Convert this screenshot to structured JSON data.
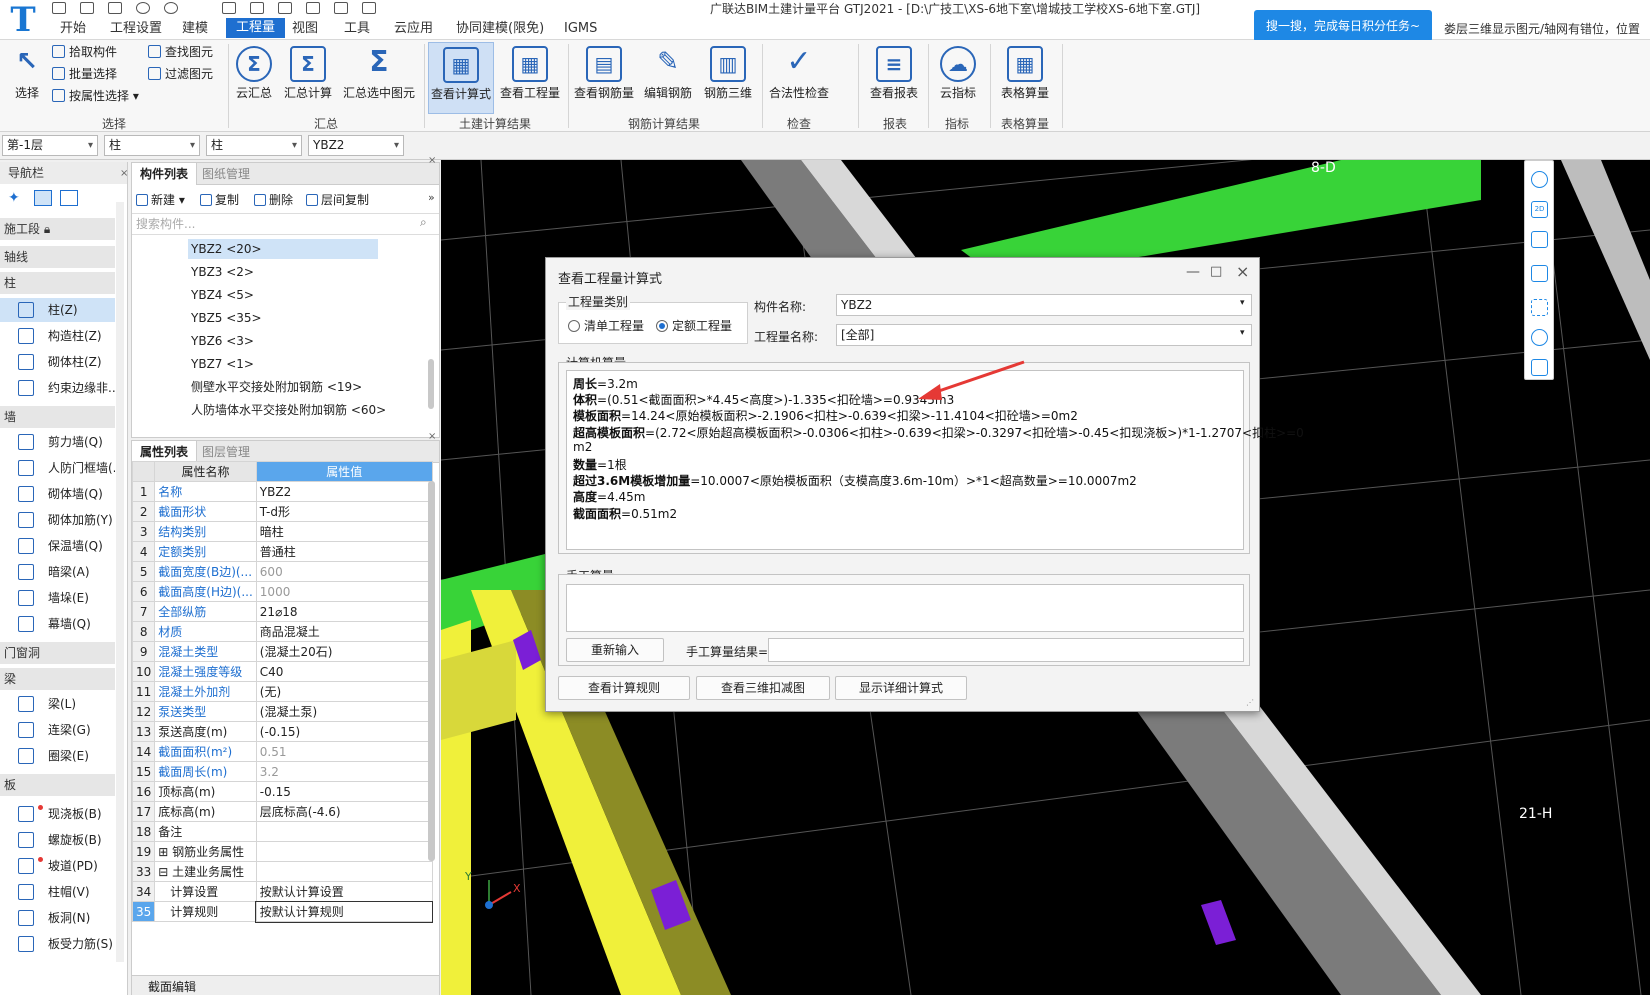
{
  "app": {
    "logo": "T",
    "title": "广联达BIM土建计量平台 GTJ2021 - [D:\\广技工\\XS-6地下室\\增城技工学校XS-6地下室.GTJ]",
    "search_tip": "搜一搜，完成每日积分任务~",
    "right_tip": "娄层三维显示图元/轴网有错位，位置"
  },
  "menu": [
    "开始",
    "工程设置",
    "建模",
    "工程量",
    "视图",
    "工具",
    "云应用",
    "协同建模(限免)",
    "IGMS"
  ],
  "menu_active": "工程量",
  "ribbon": {
    "select": {
      "big": "选择",
      "small": [
        "拾取构件",
        "批量选择",
        "按属性选择",
        "查找图元",
        "过滤图元"
      ],
      "group": "选择"
    },
    "summary": {
      "buttons": [
        "云汇总",
        "汇总计算",
        "汇总选中图元"
      ],
      "group": "汇总"
    },
    "civil": {
      "buttons": [
        "查看计算式",
        "查看工程量"
      ],
      "group": "土建计算结果"
    },
    "rebar": {
      "buttons": [
        "查看钢筋量",
        "编辑钢筋",
        "钢筋三维"
      ],
      "group": "钢筋计算结果"
    },
    "check": {
      "buttons": [
        "合法性检查"
      ],
      "group": "检查"
    },
    "report": {
      "buttons": [
        "查看报表"
      ],
      "group": "报表"
    },
    "index": {
      "buttons": [
        "云指标"
      ],
      "group": "指标"
    },
    "table": {
      "buttons": [
        "表格算量"
      ],
      "group": "表格算量"
    }
  },
  "combos": [
    "第-1层",
    "柱",
    "柱",
    "YBZ2"
  ],
  "nav": {
    "title": "导航栏",
    "categories": [
      "施工段",
      "轴线",
      "柱",
      "墙",
      "门窗洞",
      "梁",
      "板"
    ],
    "col_items": [
      "柱(Z)",
      "构造柱(Z)",
      "砌体柱(Z)",
      "约束边缘非..."
    ],
    "wall_items": [
      "剪力墙(Q)",
      "人防门框墙(...",
      "砌体墙(Q)",
      "砌体加筋(Y)",
      "保温墙(Q)",
      "暗梁(A)",
      "墙垛(E)",
      "幕墙(Q)"
    ],
    "beam_items": [
      "梁(L)",
      "连梁(G)",
      "圈梁(E)"
    ],
    "slab_items": [
      "现浇板(B)",
      "螺旋板(B)",
      "坡道(PD)",
      "柱帽(V)",
      "板洞(N)",
      "板受力筋(S)"
    ]
  },
  "comp_list": {
    "tabs": [
      "构件列表",
      "图纸管理"
    ],
    "toolbar": [
      "新建",
      "复制",
      "删除",
      "层间复制"
    ],
    "search_placeholder": "搜索构件...",
    "items": [
      "YBZ2 <20>",
      "YBZ3 <2>",
      "YBZ4 <5>",
      "YBZ5 <35>",
      "YBZ6 <3>",
      "YBZ7 <1>",
      "侧壁水平交接处附加钢筋 <19>",
      "人防墙体水平交接处附加钢筋 <60>"
    ]
  },
  "prop_list": {
    "tabs": [
      "属性列表",
      "图层管理"
    ],
    "col_name": "属性名称",
    "col_value": "属性值",
    "rows": [
      {
        "n": "1",
        "name": "名称",
        "val": "YBZ2",
        "blue": true,
        "gray": false
      },
      {
        "n": "2",
        "name": "截面形状",
        "val": "T-d形",
        "blue": true,
        "gray": false
      },
      {
        "n": "3",
        "name": "结构类别",
        "val": "暗柱",
        "blue": true,
        "gray": false
      },
      {
        "n": "4",
        "name": "定额类别",
        "val": "普通柱",
        "blue": true,
        "gray": false
      },
      {
        "n": "5",
        "name": "截面宽度(B边)(...",
        "val": "600",
        "blue": true,
        "gray": true
      },
      {
        "n": "6",
        "name": "截面高度(H边)(...",
        "val": "1000",
        "blue": true,
        "gray": true
      },
      {
        "n": "7",
        "name": "全部纵筋",
        "val": "21⌀18",
        "blue": true,
        "gray": false
      },
      {
        "n": "8",
        "name": "材质",
        "val": "商品混凝土",
        "blue": true,
        "gray": false
      },
      {
        "n": "9",
        "name": "混凝土类型",
        "val": "(混凝土20石)",
        "blue": true,
        "gray": false
      },
      {
        "n": "10",
        "name": "混凝土强度等级",
        "val": "C40",
        "blue": true,
        "gray": false
      },
      {
        "n": "11",
        "name": "混凝土外加剂",
        "val": "(无)",
        "blue": true,
        "gray": false
      },
      {
        "n": "12",
        "name": "泵送类型",
        "val": "(混凝土泵)",
        "blue": true,
        "gray": false
      },
      {
        "n": "13",
        "name": "泵送高度(m)",
        "val": "(-0.15)",
        "blue": false,
        "gray": false
      },
      {
        "n": "14",
        "name": "截面面积(m²)",
        "val": "0.51",
        "blue": true,
        "gray": true
      },
      {
        "n": "15",
        "name": "截面周长(m)",
        "val": "3.2",
        "blue": true,
        "gray": true
      },
      {
        "n": "16",
        "name": "顶标高(m)",
        "val": "-0.15",
        "blue": false,
        "gray": false
      },
      {
        "n": "17",
        "name": "底标高(m)",
        "val": "层底标高(-4.6)",
        "blue": false,
        "gray": false
      },
      {
        "n": "18",
        "name": "备注",
        "val": "",
        "blue": false,
        "gray": false
      },
      {
        "n": "19",
        "name": "⊞ 钢筋业务属性",
        "val": "",
        "blue": false,
        "gray": false
      },
      {
        "n": "33",
        "name": "⊟ 土建业务属性",
        "val": "",
        "blue": false,
        "gray": false
      },
      {
        "n": "34",
        "name": "　计算设置",
        "val": "按默认计算设置",
        "blue": false,
        "gray": false
      },
      {
        "n": "35",
        "name": "　计算规则",
        "val": "按默认计算规则",
        "blue": false,
        "gray": false
      }
    ],
    "bottom_tab": "截面编辑"
  },
  "dialog": {
    "title": "查看工程量计算式",
    "group_type": "工程量类别",
    "radio1": "清单工程量",
    "radio2": "定额工程量",
    "comp_name_label": "构件名称:",
    "comp_name_value": "YBZ2",
    "qty_name_label": "工程量名称:",
    "qty_name_value": "[全部]",
    "computer_label": "计算机算量",
    "lines": [
      {
        "k": "周长",
        "v": "=3.2m"
      },
      {
        "k": "体积",
        "v": "=(0.51<截面面积>*4.45<高度>)-1.335<扣砼墙>=0.9345m3"
      },
      {
        "k": "模板面积",
        "v": "=14.24<原始模板面积>-2.1906<扣柱>-0.639<扣梁>-11.4104<扣砼墙>=0m2"
      },
      {
        "k": "超高模板面积",
        "v": "=(2.72<原始超高模板面积>-0.0306<扣柱>-0.639<扣梁>-0.3297<扣砼墙>-0.45<扣现浇板>)*1-1.2707<扣柱>=0"
      },
      {
        "k": "",
        "v": "m2"
      },
      {
        "k": "数量",
        "v": "=1根"
      },
      {
        "k": "超过3.6M模板增加量",
        "v": "=10.0007<原始模板面积（支模高度3.6m-10m）>*1<超高数量>=10.0007m2"
      },
      {
        "k": "高度",
        "v": "=4.45m"
      },
      {
        "k": "截面面积",
        "v": "=0.51m2"
      }
    ],
    "manual_label": "手工算量",
    "reinput": "重新输入",
    "manual_result_label": "手工算量结果=",
    "btn_rules": "查看计算规则",
    "btn_3d": "查看三维扣减图",
    "btn_detail": "显示详细计算式"
  },
  "viewport": {
    "axis_top": "8-D",
    "axis_right": "21-H",
    "axis_x": "X",
    "axis_y": "Y"
  },
  "colors": {
    "accent": "#1e6fd0",
    "green_beam": "#3bd43b",
    "yellow_beam": "#f2f23a",
    "purple": "#7b1fd6",
    "arrow_red": "#e53935"
  }
}
